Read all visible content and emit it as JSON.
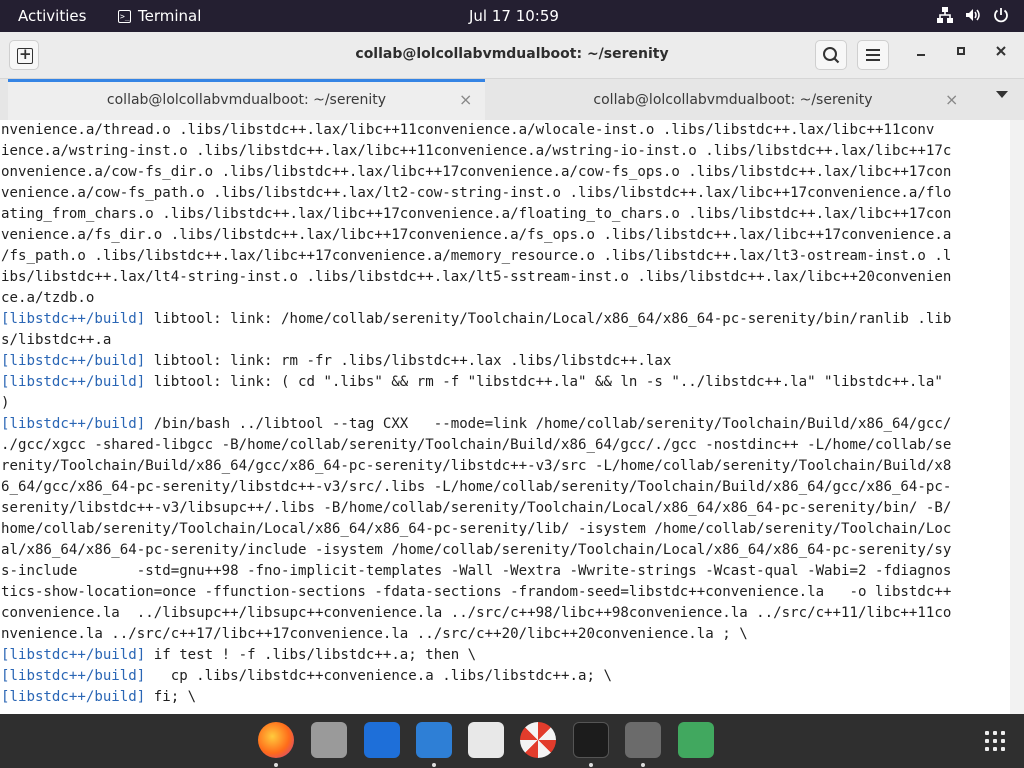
{
  "topbar": {
    "activities": "Activities",
    "app_name": "Terminal",
    "clock": "Jul 17  10:59"
  },
  "window": {
    "title": "collab@lolcollabvmdualboot: ~/serenity"
  },
  "tabs": [
    {
      "label": "collab@lolcollabvmdualboot: ~/serenity",
      "active": true
    },
    {
      "label": "collab@lolcollabvmdualboot: ~/serenity",
      "active": false
    }
  ],
  "terminal": {
    "lines": [
      {
        "p": "",
        "t": "nvenience.a/thread.o .libs/libstdc++.lax/libc++11convenience.a/wlocale-inst.o .libs/libstdc++.lax/libc++11conv"
      },
      {
        "p": "",
        "t": "ience.a/wstring-inst.o .libs/libstdc++.lax/libc++11convenience.a/wstring-io-inst.o .libs/libstdc++.lax/libc++17c"
      },
      {
        "p": "",
        "t": "onvenience.a/cow-fs_dir.o .libs/libstdc++.lax/libc++17convenience.a/cow-fs_ops.o .libs/libstdc++.lax/libc++17con"
      },
      {
        "p": "",
        "t": "venience.a/cow-fs_path.o .libs/libstdc++.lax/lt2-cow-string-inst.o .libs/libstdc++.lax/libc++17convenience.a/flo"
      },
      {
        "p": "",
        "t": "ating_from_chars.o .libs/libstdc++.lax/libc++17convenience.a/floating_to_chars.o .libs/libstdc++.lax/libc++17con"
      },
      {
        "p": "",
        "t": "venience.a/fs_dir.o .libs/libstdc++.lax/libc++17convenience.a/fs_ops.o .libs/libstdc++.lax/libc++17convenience.a"
      },
      {
        "p": "",
        "t": "/fs_path.o .libs/libstdc++.lax/libc++17convenience.a/memory_resource.o .libs/libstdc++.lax/lt3-ostream-inst.o .l"
      },
      {
        "p": "",
        "t": "ibs/libstdc++.lax/lt4-string-inst.o .libs/libstdc++.lax/lt5-sstream-inst.o .libs/libstdc++.lax/libc++20convenien"
      },
      {
        "p": "",
        "t": "ce.a/tzdb.o"
      },
      {
        "p": "[libstdc++/build]",
        "t": " libtool: link: /home/collab/serenity/Toolchain/Local/x86_64/x86_64-pc-serenity/bin/ranlib .lib"
      },
      {
        "p": "",
        "t": "s/libstdc++.a"
      },
      {
        "p": "[libstdc++/build]",
        "t": " libtool: link: rm -fr .libs/libstdc++.lax .libs/libstdc++.lax"
      },
      {
        "p": "[libstdc++/build]",
        "t": " libtool: link: ( cd \".libs\" && rm -f \"libstdc++.la\" && ln -s \"../libstdc++.la\" \"libstdc++.la\""
      },
      {
        "p": "",
        "t": ")"
      },
      {
        "p": "[libstdc++/build]",
        "t": " /bin/bash ../libtool --tag CXX   --mode=link /home/collab/serenity/Toolchain/Build/x86_64/gcc/"
      },
      {
        "p": "",
        "t": "./gcc/xgcc -shared-libgcc -B/home/collab/serenity/Toolchain/Build/x86_64/gcc/./gcc -nostdinc++ -L/home/collab/se"
      },
      {
        "p": "",
        "t": "renity/Toolchain/Build/x86_64/gcc/x86_64-pc-serenity/libstdc++-v3/src -L/home/collab/serenity/Toolchain/Build/x8"
      },
      {
        "p": "",
        "t": "6_64/gcc/x86_64-pc-serenity/libstdc++-v3/src/.libs -L/home/collab/serenity/Toolchain/Build/x86_64/gcc/x86_64-pc-"
      },
      {
        "p": "",
        "t": "serenity/libstdc++-v3/libsupc++/.libs -B/home/collab/serenity/Toolchain/Local/x86_64/x86_64-pc-serenity/bin/ -B/"
      },
      {
        "p": "",
        "t": "home/collab/serenity/Toolchain/Local/x86_64/x86_64-pc-serenity/lib/ -isystem /home/collab/serenity/Toolchain/Loc"
      },
      {
        "p": "",
        "t": "al/x86_64/x86_64-pc-serenity/include -isystem /home/collab/serenity/Toolchain/Local/x86_64/x86_64-pc-serenity/sy"
      },
      {
        "p": "",
        "t": "s-include       -std=gnu++98 -fno-implicit-templates -Wall -Wextra -Wwrite-strings -Wcast-qual -Wabi=2 -fdiagnos"
      },
      {
        "p": "",
        "t": "tics-show-location=once -ffunction-sections -fdata-sections -frandom-seed=libstdc++convenience.la   -o libstdc++"
      },
      {
        "p": "",
        "t": "convenience.la  ../libsupc++/libsupc++convenience.la ../src/c++98/libc++98convenience.la ../src/c++11/libc++11co"
      },
      {
        "p": "",
        "t": "nvenience.la ../src/c++17/libc++17convenience.la ../src/c++20/libc++20convenience.la ; \\"
      },
      {
        "p": "[libstdc++/build]",
        "t": " if test ! -f .libs/libstdc++.a; then \\"
      },
      {
        "p": "[libstdc++/build]",
        "t": "   cp .libs/libstdc++convenience.a .libs/libstdc++.a; \\"
      },
      {
        "p": "[libstdc++/build]",
        "t": " fi; \\"
      }
    ]
  },
  "dock": {
    "apps": [
      {
        "name": "firefox-icon",
        "color": "#e66000",
        "running": true
      },
      {
        "name": "evolution-icon",
        "color": "#9a9a9a",
        "running": false
      },
      {
        "name": "writer-icon",
        "color": "#1e6fd9",
        "running": false
      },
      {
        "name": "documents-icon",
        "color": "#2e7fd6",
        "running": true
      },
      {
        "name": "software-icon",
        "color": "#e8e8e8",
        "running": false
      },
      {
        "name": "help-icon",
        "color": "#e23c2c",
        "running": false
      },
      {
        "name": "terminal-icon",
        "color": "#1c1c1c",
        "running": true
      },
      {
        "name": "vm-icon",
        "color": "#6b6b6b",
        "running": true
      },
      {
        "name": "trash-icon",
        "color": "#41a85f",
        "running": false
      }
    ]
  }
}
